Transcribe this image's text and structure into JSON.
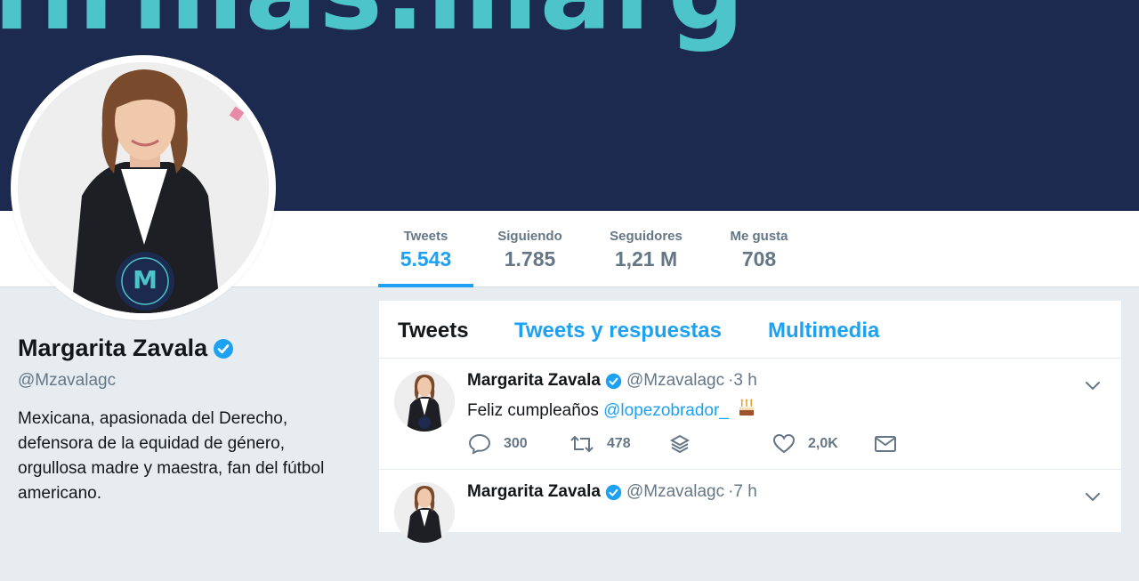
{
  "banner": {
    "text": "firmas.marg"
  },
  "nav": {
    "stats": [
      {
        "label": "Tweets",
        "value": "5.543"
      },
      {
        "label": "Siguiendo",
        "value": "1.785"
      },
      {
        "label": "Seguidores",
        "value": "1,21 M"
      },
      {
        "label": "Me gusta",
        "value": "708"
      }
    ]
  },
  "profile": {
    "name": "Margarita Zavala",
    "handle": "@Mzavalagc",
    "bio": "Mexicana, apasionada del Derecho, defensora de la equidad de género, orgullosa madre y maestra, fan del fútbol americano.",
    "avatar_badge": "M"
  },
  "timeline": {
    "tabs": [
      "Tweets",
      "Tweets y respuestas",
      "Multimedia"
    ],
    "tweets": [
      {
        "name": "Margarita Zavala",
        "handle": "@Mzavalagc",
        "time": "·3 h",
        "text": "Feliz cumpleaños ",
        "mention": "@lopezobrador_",
        "replies": "300",
        "retweets": "478",
        "likes": "2,0K"
      },
      {
        "name": "Margarita Zavala",
        "handle": "@Mzavalagc",
        "time": "·7 h"
      }
    ]
  },
  "colors": {
    "accent": "#1da1f2",
    "banner_bg": "#1b2a4e",
    "banner_text": "#4cc4c8"
  },
  "icons": [
    "verified-icon",
    "reply-icon",
    "retweet-icon",
    "stack-icon",
    "heart-icon",
    "envelope-icon",
    "chevron-down-icon",
    "cake-icon"
  ]
}
